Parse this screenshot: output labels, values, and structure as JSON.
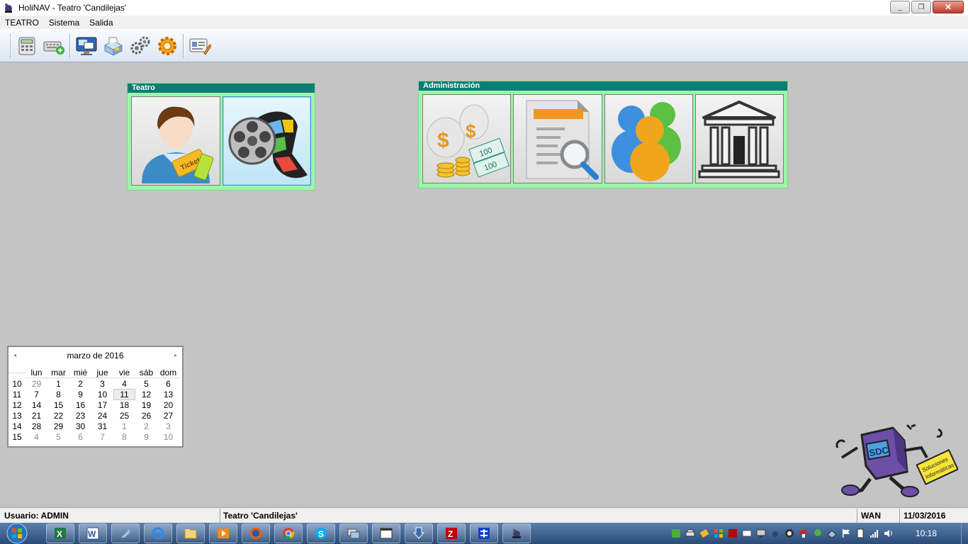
{
  "window": {
    "title": "HoliNAV - Teatro 'Candilejas'",
    "minimize": "_",
    "maximize": "❐",
    "close": "✕"
  },
  "menu": {
    "items": [
      "TEATRO",
      "Sistema",
      "Salida"
    ]
  },
  "toolbar": {
    "icons": [
      "calculator-icon",
      "keyboard-add-icon",
      "monitor-windows-icon",
      "printer-icon",
      "gears-icon",
      "settings-gear-icon",
      "edit-card-icon"
    ]
  },
  "panels": {
    "teatro": {
      "title": "Teatro",
      "tiles": [
        "ticket-user-icon",
        "film-reel-icon"
      ]
    },
    "administracion": {
      "title": "Administración",
      "tiles": [
        "money-bags-icon",
        "document-search-icon",
        "users-group-icon",
        "bank-building-icon"
      ]
    }
  },
  "calendar": {
    "month_label": "marzo de 2016",
    "prev": "◂",
    "next": "▸",
    "weekdays": [
      "lun",
      "mar",
      "mié",
      "jue",
      "vie",
      "sáb",
      "dom"
    ],
    "weeks": [
      {
        "wk": "10",
        "days": [
          "29",
          "1",
          "2",
          "3",
          "4",
          "5",
          "6"
        ]
      },
      {
        "wk": "11",
        "days": [
          "7",
          "8",
          "9",
          "10",
          "11",
          "12",
          "13"
        ]
      },
      {
        "wk": "12",
        "days": [
          "14",
          "15",
          "16",
          "17",
          "18",
          "19",
          "20"
        ]
      },
      {
        "wk": "13",
        "days": [
          "21",
          "22",
          "23",
          "24",
          "25",
          "26",
          "27"
        ]
      },
      {
        "wk": "14",
        "days": [
          "28",
          "29",
          "30",
          "31",
          "1",
          "2",
          "3"
        ]
      },
      {
        "wk": "15",
        "days": [
          "4",
          "5",
          "6",
          "7",
          "8",
          "9",
          "10"
        ]
      }
    ],
    "today": "11"
  },
  "logo": {
    "letters": "SDC",
    "sign_line1": "Soluciones",
    "sign_line2": "Informáticas"
  },
  "statusbar": {
    "user": "Usuario: ADMIN",
    "venue": "Teatro 'Candilejas'",
    "network": "WAN",
    "date": "11/03/2016"
  },
  "taskbar": {
    "apps": [
      "excel-icon",
      "word-icon",
      "app-icon",
      "ie-icon",
      "explorer-icon",
      "media-icon",
      "firefox-icon",
      "chrome-icon",
      "skype-icon",
      "remote-icon",
      "window-icon",
      "download-icon",
      "filezilla-icon",
      "network-icon",
      "holinav-icon"
    ],
    "clock": "10:18"
  }
}
